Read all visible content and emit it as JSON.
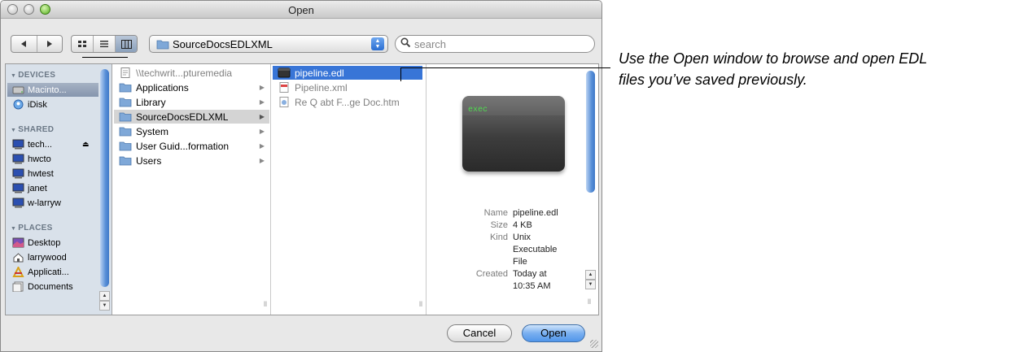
{
  "window": {
    "title": "Open"
  },
  "toolbar": {
    "back_icon": "back-arrow-icon",
    "forward_icon": "forward-arrow-icon",
    "view_icons": [
      "icon-view-icon",
      "list-view-icon",
      "column-view-icon"
    ],
    "path_popup": "SourceDocsEDLXML",
    "search_placeholder": "search"
  },
  "sidebar": {
    "sections": [
      {
        "label": "DEVICES",
        "items": [
          {
            "label": "Macinto...",
            "icon": "hard-drive-icon",
            "selected": true
          },
          {
            "label": "iDisk",
            "icon": "idisk-icon"
          }
        ]
      },
      {
        "label": "SHARED",
        "items": [
          {
            "label": "tech...",
            "icon": "computer-icon",
            "eject": "⏏"
          },
          {
            "label": "hwcto",
            "icon": "computer-icon"
          },
          {
            "label": "hwtest",
            "icon": "computer-icon"
          },
          {
            "label": "janet",
            "icon": "computer-icon"
          },
          {
            "label": "w-larryw",
            "icon": "computer-icon"
          }
        ]
      },
      {
        "label": "PLACES",
        "items": [
          {
            "label": "Desktop",
            "icon": "desktop-icon"
          },
          {
            "label": "larrywood",
            "icon": "home-icon"
          },
          {
            "label": "Applicati...",
            "icon": "applications-icon"
          },
          {
            "label": "Documents",
            "icon": "documents-icon"
          }
        ]
      }
    ]
  },
  "columns": {
    "col1": [
      {
        "label": "\\\\techwrit...pturemedia",
        "icon": "document-icon",
        "dim": true
      },
      {
        "label": "Applications",
        "icon": "folder-icon",
        "chevron": true
      },
      {
        "label": "Library",
        "icon": "folder-icon",
        "chevron": true
      },
      {
        "label": "SourceDocsEDLXML",
        "icon": "folder-icon",
        "chevron": true,
        "selected": "gray"
      },
      {
        "label": "System",
        "icon": "folder-icon",
        "chevron": true
      },
      {
        "label": "User Guid...formation",
        "icon": "folder-icon",
        "chevron": true
      },
      {
        "label": "Users",
        "icon": "folder-icon",
        "chevron": true
      }
    ],
    "col2": [
      {
        "label": "pipeline.edl",
        "icon": "executable-icon",
        "selected": "blue"
      },
      {
        "label": "Pipeline.xml",
        "icon": "xml-file-icon",
        "dim": true
      },
      {
        "label": "Re Q abt F...ge Doc.htm",
        "icon": "html-file-icon",
        "dim": true
      }
    ]
  },
  "preview": {
    "thumbnail_text": "exec",
    "info": [
      {
        "key": "Name",
        "values": [
          "pipeline.edl"
        ]
      },
      {
        "key": "Size",
        "values": [
          "4 KB"
        ]
      },
      {
        "key": "Kind",
        "values": [
          "Unix",
          "Executable",
          "File"
        ]
      },
      {
        "key": "Created",
        "values": [
          "Today at",
          "10:35 AM"
        ]
      }
    ]
  },
  "buttons": {
    "cancel": "Cancel",
    "open": "Open"
  },
  "callout": {
    "line1": "Use the Open window to browse and open EDL",
    "line2": "files you’ve saved previously."
  },
  "colors": {
    "selection_blue": "#3875d7",
    "sidebar_bg": "#d9e1ea",
    "default_button": "#79aff0"
  }
}
